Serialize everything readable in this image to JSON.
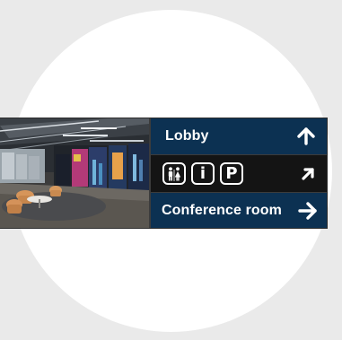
{
  "sign": {
    "rows": [
      {
        "label": "Lobby",
        "arrow": "arrow-up-icon"
      },
      {
        "icons": [
          "restroom-icon",
          "information-icon",
          "parking-icon"
        ],
        "icon_letters": {
          "info": "i",
          "parking": "P"
        },
        "arrow": "arrow-up-right-icon"
      },
      {
        "label": "Conference room",
        "arrow": "arrow-right-icon"
      }
    ]
  },
  "colors": {
    "background": "#eaeaea",
    "circle": "#ffffff",
    "panel_blue": "#0c3152",
    "panel_black": "#141414",
    "frame": "#3c3c3c",
    "text": "#ffffff"
  },
  "photo": {
    "subject": "office-lobby-photo"
  }
}
